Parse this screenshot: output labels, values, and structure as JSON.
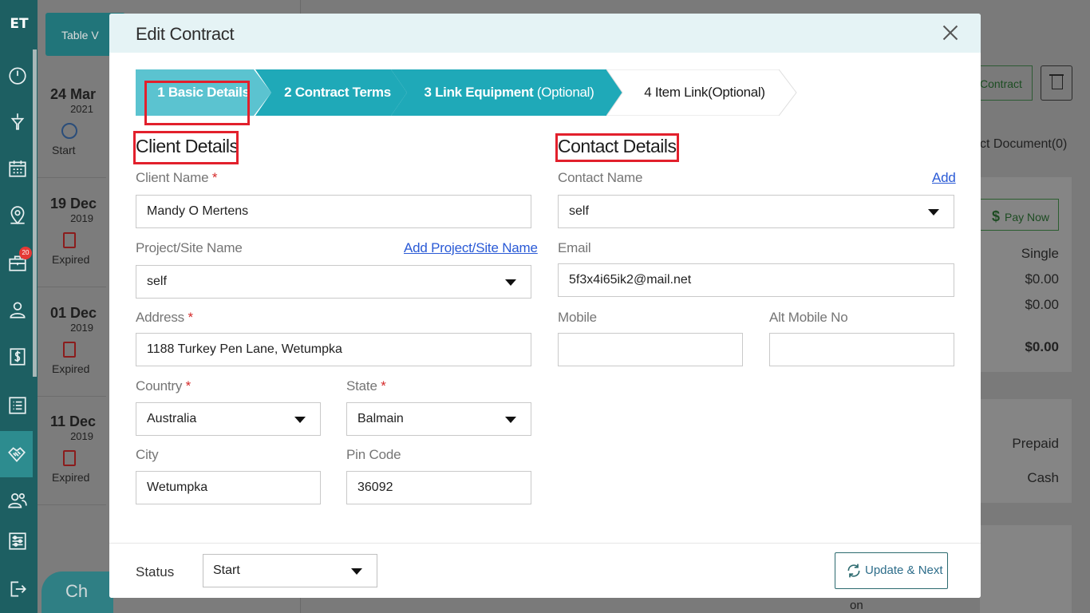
{
  "app": {
    "logo": "ET"
  },
  "rail": {
    "icons": [
      "dashboard-icon",
      "funnel-icon",
      "calendar-icon",
      "map-pin-icon",
      "briefcase-icon",
      "user-icon",
      "dollar-doc-icon",
      "list-icon",
      "handshake-icon",
      "users-icon",
      "settings-sliders-icon",
      "logout-icon"
    ],
    "badge": "20"
  },
  "background": {
    "table_view_label": "Table V",
    "timeline": [
      {
        "date": "24 Mar",
        "year": "2021",
        "status": "Start"
      },
      {
        "date": "19 Dec",
        "year": "2019",
        "status": "Expired"
      },
      {
        "date": "01 Dec",
        "year": "2019",
        "status": "Expired"
      },
      {
        "date": "11 Dec",
        "year": "2019",
        "status": "Expired"
      }
    ],
    "contract_button": "Contract",
    "document_tab": "ct Document(0)",
    "pay_now": "Pay Now",
    "summary": [
      "Single",
      "$0.00",
      "$0.00",
      "$0.00"
    ],
    "payment": [
      "Prepaid",
      "Cash"
    ],
    "bottom_word": "on",
    "chat_label": "Ch"
  },
  "modal": {
    "title": "Edit Contract",
    "steps": [
      {
        "num": "1",
        "label": "Basic Details",
        "optional": ""
      },
      {
        "num": "2",
        "label": "Contract Terms",
        "optional": ""
      },
      {
        "num": "3",
        "label": "Link Equipment",
        "optional": "(Optional)"
      },
      {
        "num": "4",
        "label": "Item Link(Optional)",
        "optional": ""
      }
    ],
    "client": {
      "heading": "Client Details",
      "client_name_label": "Client Name",
      "client_name": "Mandy O Mertens",
      "project_label": "Project/Site Name",
      "project_link": "Add Project/Site Name",
      "project": "self",
      "address_label": "Address",
      "address": "1188  Turkey Pen Lane, Wetumpka",
      "country_label": "Country",
      "country": "Australia",
      "state_label": "State",
      "state": "Balmain",
      "city_label": "City",
      "city": "Wetumpka",
      "pin_label": "Pin Code",
      "pin": "36092",
      "required_mark": "*"
    },
    "contact": {
      "heading": "Contact Details",
      "contact_name_label": "Contact Name",
      "add_link": "Add",
      "contact_name": "self",
      "email_label": "Email",
      "email": "5f3x4i65ik2@mail.net",
      "mobile_label": "Mobile",
      "mobile": "",
      "alt_mobile_label": "Alt Mobile No",
      "alt_mobile": ""
    },
    "footer": {
      "status_label": "Status",
      "status": "Start",
      "update_button": "Update & Next"
    }
  },
  "colors": {
    "rail": "#1d5f62",
    "step_active": "#5bc3d0",
    "step": "#1fa9b8",
    "highlight": "#e2202c",
    "link": "#2a5ad6"
  }
}
